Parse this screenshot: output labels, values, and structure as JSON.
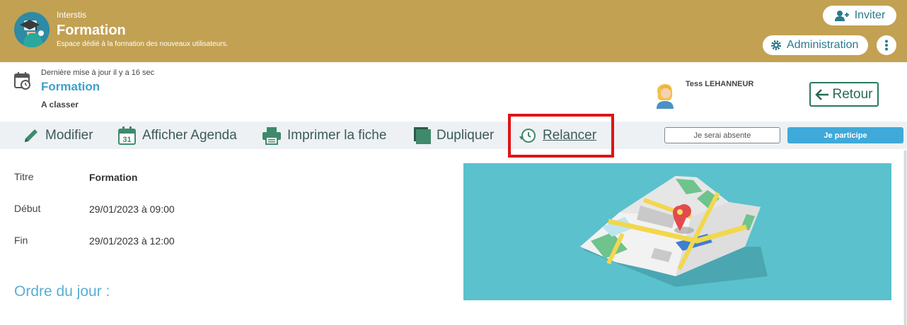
{
  "header": {
    "org_name": "Interstis",
    "app_title": "Formation",
    "subtitle": "Espace dédié à la formation des nouveaux utilisateurs.",
    "invite_label": "Inviter",
    "admin_label": "Administration",
    "colors": {
      "header_bg": "#c2a153",
      "accent": "#2a7a8c"
    }
  },
  "record": {
    "last_updated": "Dernière mise à jour il y a 16 sec",
    "title": "Formation",
    "status": "A classer",
    "user_name": "Tess LEHANNEUR",
    "back_label": "Retour"
  },
  "toolbar": {
    "edit_label": "Modifier",
    "agenda_label": "Afficher Agenda",
    "agenda_day": "31",
    "print_label": "Imprimer la fiche",
    "duplicate_label": "Dupliquer",
    "remind_label": "Relancer",
    "absent_label": "Je serai absente",
    "participate_label": "Je participe"
  },
  "details": {
    "fields": [
      {
        "label": "Titre",
        "value": "Formation"
      },
      {
        "label": "Début",
        "value": "29/01/2023 à 09:00"
      },
      {
        "label": "Fin",
        "value": "29/01/2023 à 12:00"
      }
    ],
    "agenda_heading": "Ordre du jour :"
  }
}
